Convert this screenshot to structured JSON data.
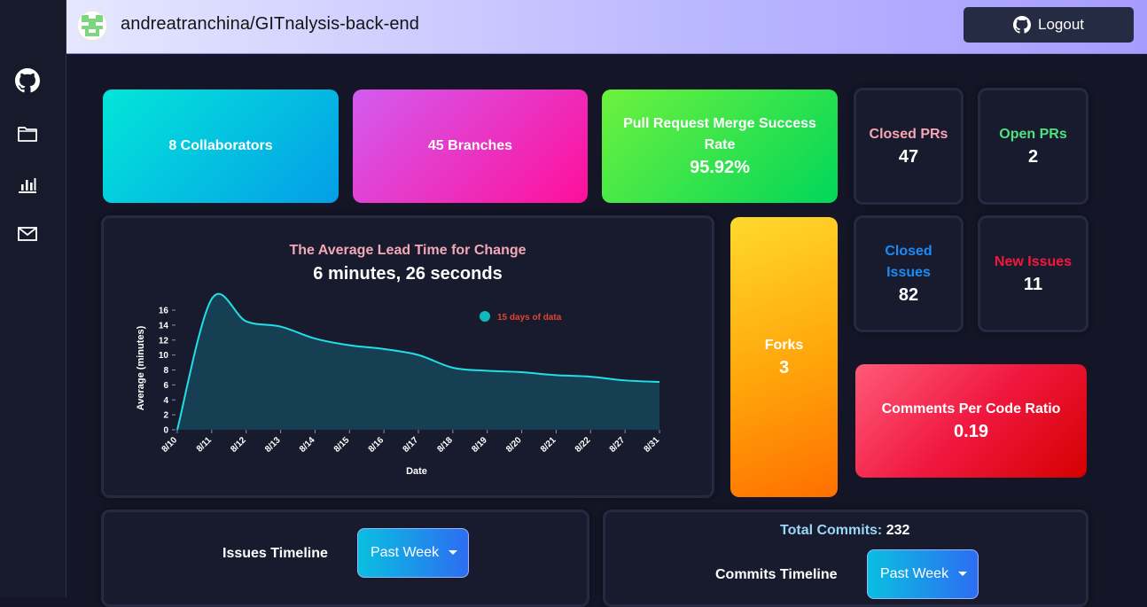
{
  "header": {
    "repo_title": "andreatranchina/GITnalysis-back-end",
    "logout_label": "Logout"
  },
  "sidebar": {
    "icons": [
      "github-icon",
      "folder-icon",
      "bar-chart-icon",
      "mail-icon"
    ]
  },
  "stats": {
    "collaborators": "8 Collaborators",
    "branches": "45 Branches",
    "merge_label": "Pull Request Merge Success Rate",
    "merge_value": "95.92%",
    "closed_prs_label": "Closed PRs",
    "closed_prs_value": "47",
    "open_prs_label": "Open PRs",
    "open_prs_value": "2",
    "closed_issues_label": "Closed Issues",
    "closed_issues_value": "82",
    "new_issues_label": "New Issues",
    "new_issues_value": "11",
    "forks_label": "Forks",
    "forks_value": "3",
    "comments_label": "Comments Per Code Ratio",
    "comments_value": "0.19"
  },
  "lead_time": {
    "title": "The Average Lead Time for Change",
    "value": "6 minutes, 26 seconds"
  },
  "chart_data": {
    "type": "area",
    "title": "The Average Lead Time for Change",
    "subtitle": "6 minutes, 26 seconds",
    "xlabel": "Date",
    "ylabel": "Average (minutes)",
    "x": [
      "8/10",
      "8/11",
      "8/12",
      "8/13",
      "8/14",
      "8/15",
      "8/16",
      "8/17",
      "8/18",
      "8/19",
      "8/20",
      "8/21",
      "8/22",
      "8/27",
      "8/31"
    ],
    "series": [
      {
        "name": "15 days of data",
        "values": [
          0,
          17.5,
          14.5,
          13.8,
          12.2,
          11.3,
          10.8,
          10.0,
          8.3,
          7.9,
          7.7,
          7.3,
          7.1,
          6.6,
          6.4
        ]
      }
    ],
    "ylim": [
      0,
      16
    ],
    "yticks": [
      0,
      2,
      4,
      6,
      8,
      10,
      12,
      14,
      16
    ],
    "legend": "top-right",
    "colors": {
      "line": "#1fe0e6",
      "fill": "#173f53",
      "legend_text": "#e0452e"
    }
  },
  "timeline": {
    "issues_label": "Issues Timeline",
    "issues_range": "Past Week",
    "total_commits_label": "Total Commits:",
    "total_commits_value": "232",
    "commits_label": "Commits Timeline",
    "commits_range": "Past Week"
  }
}
